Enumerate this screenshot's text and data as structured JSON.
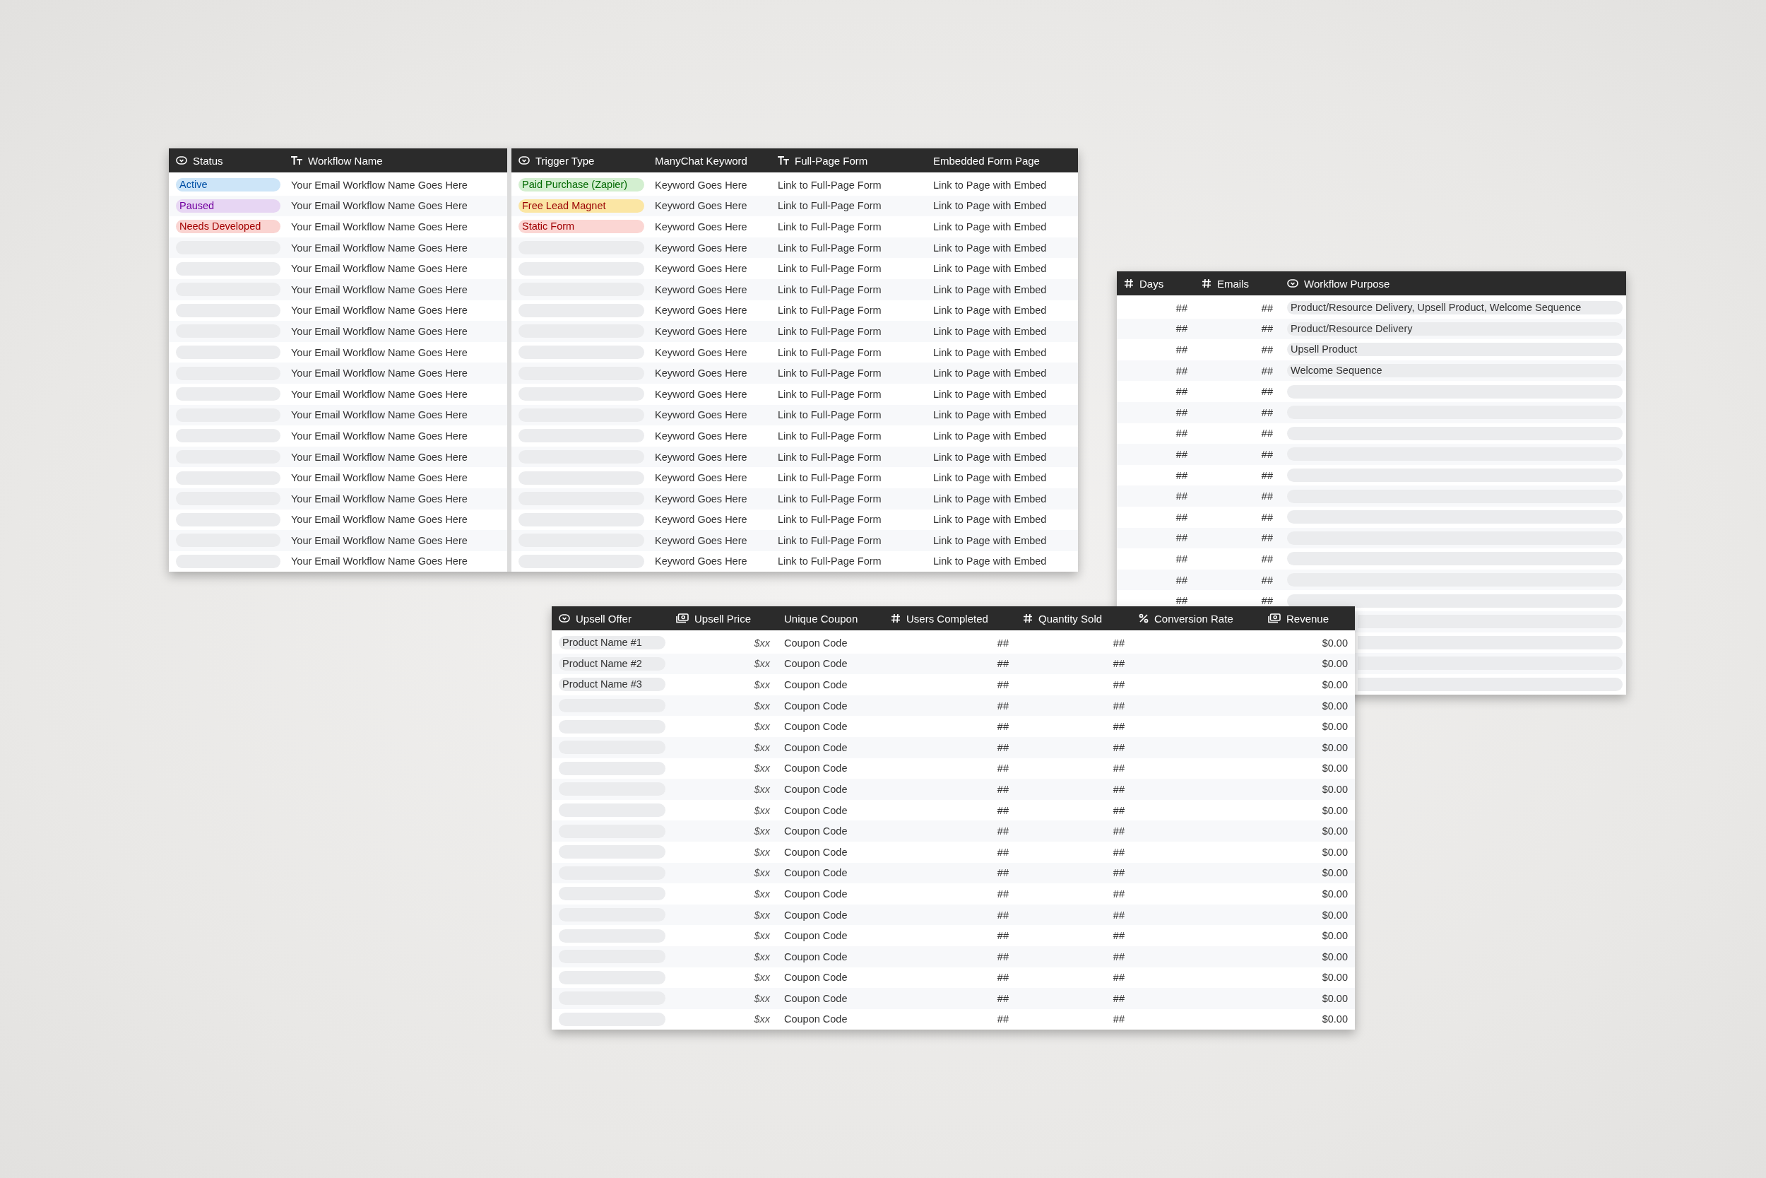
{
  "workflows_table": {
    "columns": [
      {
        "label": "Status",
        "kind": "select"
      },
      {
        "label": "Workflow Name",
        "kind": "text"
      },
      {
        "label": "Trigger Type",
        "kind": "select"
      },
      {
        "label": "ManyChat Keyword",
        "kind": "plain"
      },
      {
        "label": "Full-Page Form",
        "kind": "text"
      },
      {
        "label": "Embedded Form Page",
        "kind": "plain"
      }
    ],
    "rows": [
      {
        "status": {
          "label": "Active",
          "color": "#cde5f8"
        },
        "name": "Your Email Workflow Name Goes Here",
        "trigger": {
          "label": "Paid Purchase (Zapier)",
          "color": "#d3efd0"
        },
        "keyword": "Keyword Goes Here",
        "form": "Link to Full-Page Form",
        "embed": "Link to Page with Embed"
      },
      {
        "status": {
          "label": "Paused",
          "color": "#e7d6f3"
        },
        "name": "Your Email Workflow Name Goes Here",
        "trigger": {
          "label": "Free Lead Magnet",
          "color": "#fbe6a4"
        },
        "keyword": "Keyword Goes Here",
        "form": "Link to Full-Page Form",
        "embed": "Link to Page with Embed"
      },
      {
        "status": {
          "label": "Needs Developed",
          "color": "#fad4d1"
        },
        "name": "Your Email Workflow Name Goes Here",
        "trigger": {
          "label": "Static Form",
          "color": "#fbd6d3"
        },
        "keyword": "Keyword Goes Here",
        "form": "Link to Full-Page Form",
        "embed": "Link to Page with Embed"
      },
      {
        "name": "Your Email Workflow Name Goes Here",
        "keyword": "Keyword Goes Here",
        "form": "Link to Full-Page Form",
        "embed": "Link to Page with Embed"
      },
      {
        "name": "Your Email Workflow Name Goes Here",
        "keyword": "Keyword Goes Here",
        "form": "Link to Full-Page Form",
        "embed": "Link to Page with Embed"
      },
      {
        "name": "Your Email Workflow Name Goes Here",
        "keyword": "Keyword Goes Here",
        "form": "Link to Full-Page Form",
        "embed": "Link to Page with Embed"
      },
      {
        "name": "Your Email Workflow Name Goes Here",
        "keyword": "Keyword Goes Here",
        "form": "Link to Full-Page Form",
        "embed": "Link to Page with Embed"
      },
      {
        "name": "Your Email Workflow Name Goes Here",
        "keyword": "Keyword Goes Here",
        "form": "Link to Full-Page Form",
        "embed": "Link to Page with Embed"
      },
      {
        "name": "Your Email Workflow Name Goes Here",
        "keyword": "Keyword Goes Here",
        "form": "Link to Full-Page Form",
        "embed": "Link to Page with Embed"
      },
      {
        "name": "Your Email Workflow Name Goes Here",
        "keyword": "Keyword Goes Here",
        "form": "Link to Full-Page Form",
        "embed": "Link to Page with Embed"
      },
      {
        "name": "Your Email Workflow Name Goes Here",
        "keyword": "Keyword Goes Here",
        "form": "Link to Full-Page Form",
        "embed": "Link to Page with Embed"
      },
      {
        "name": "Your Email Workflow Name Goes Here",
        "keyword": "Keyword Goes Here",
        "form": "Link to Full-Page Form",
        "embed": "Link to Page with Embed"
      },
      {
        "name": "Your Email Workflow Name Goes Here",
        "keyword": "Keyword Goes Here",
        "form": "Link to Full-Page Form",
        "embed": "Link to Page with Embed"
      },
      {
        "name": "Your Email Workflow Name Goes Here",
        "keyword": "Keyword Goes Here",
        "form": "Link to Full-Page Form",
        "embed": "Link to Page with Embed"
      },
      {
        "name": "Your Email Workflow Name Goes Here",
        "keyword": "Keyword Goes Here",
        "form": "Link to Full-Page Form",
        "embed": "Link to Page with Embed"
      },
      {
        "name": "Your Email Workflow Name Goes Here",
        "keyword": "Keyword Goes Here",
        "form": "Link to Full-Page Form",
        "embed": "Link to Page with Embed"
      },
      {
        "name": "Your Email Workflow Name Goes Here",
        "keyword": "Keyword Goes Here",
        "form": "Link to Full-Page Form",
        "embed": "Link to Page with Embed"
      },
      {
        "name": "Your Email Workflow Name Goes Here",
        "keyword": "Keyword Goes Here",
        "form": "Link to Full-Page Form",
        "embed": "Link to Page with Embed"
      },
      {
        "name": "Your Email Workflow Name Goes Here",
        "keyword": "Keyword Goes Here",
        "form": "Link to Full-Page Form",
        "embed": "Link to Page with Embed"
      }
    ]
  },
  "purpose_table": {
    "columns": [
      {
        "label": "Days",
        "kind": "number"
      },
      {
        "label": "Emails",
        "kind": "number"
      },
      {
        "label": "Workflow Purpose",
        "kind": "select"
      }
    ],
    "rows": [
      {
        "days": "##",
        "emails": "##",
        "purpose": "Product/Resource Delivery, Upsell Product, Welcome Sequence"
      },
      {
        "days": "##",
        "emails": "##",
        "purpose": "Product/Resource Delivery"
      },
      {
        "days": "##",
        "emails": "##",
        "purpose": "Upsell Product"
      },
      {
        "days": "##",
        "emails": "##",
        "purpose": "Welcome Sequence"
      },
      {
        "days": "##",
        "emails": "##"
      },
      {
        "days": "##",
        "emails": "##"
      },
      {
        "days": "##",
        "emails": "##"
      },
      {
        "days": "##",
        "emails": "##"
      },
      {
        "days": "##",
        "emails": "##"
      },
      {
        "days": "##",
        "emails": "##"
      },
      {
        "days": "##",
        "emails": "##"
      },
      {
        "days": "##",
        "emails": "##"
      },
      {
        "days": "##",
        "emails": "##"
      },
      {
        "days": "##",
        "emails": "##"
      },
      {
        "days": "##",
        "emails": "##"
      },
      {},
      {},
      {},
      {}
    ]
  },
  "upsell_table": {
    "columns": [
      {
        "label": "Upsell Offer",
        "kind": "select"
      },
      {
        "label": "Upsell Price",
        "kind": "currency"
      },
      {
        "label": "Unique Coupon",
        "kind": "plain"
      },
      {
        "label": "Users Completed",
        "kind": "number"
      },
      {
        "label": "Quantity Sold",
        "kind": "number"
      },
      {
        "label": "Conversion Rate",
        "kind": "percent"
      },
      {
        "label": "Revenue",
        "kind": "currency"
      }
    ],
    "rows": [
      {
        "offer": "Product Name #1",
        "price": "$xx",
        "coupon": "Coupon Code",
        "users": "##",
        "sold": "##",
        "revenue": "$0.00"
      },
      {
        "offer": "Product Name #2",
        "price": "$xx",
        "coupon": "Coupon Code",
        "users": "##",
        "sold": "##",
        "revenue": "$0.00"
      },
      {
        "offer": "Product Name #3",
        "price": "$xx",
        "coupon": "Coupon Code",
        "users": "##",
        "sold": "##",
        "revenue": "$0.00"
      },
      {
        "price": "$xx",
        "coupon": "Coupon Code",
        "users": "##",
        "sold": "##",
        "revenue": "$0.00"
      },
      {
        "price": "$xx",
        "coupon": "Coupon Code",
        "users": "##",
        "sold": "##",
        "revenue": "$0.00"
      },
      {
        "price": "$xx",
        "coupon": "Coupon Code",
        "users": "##",
        "sold": "##",
        "revenue": "$0.00"
      },
      {
        "price": "$xx",
        "coupon": "Coupon Code",
        "users": "##",
        "sold": "##",
        "revenue": "$0.00"
      },
      {
        "price": "$xx",
        "coupon": "Coupon Code",
        "users": "##",
        "sold": "##",
        "revenue": "$0.00"
      },
      {
        "price": "$xx",
        "coupon": "Coupon Code",
        "users": "##",
        "sold": "##",
        "revenue": "$0.00"
      },
      {
        "price": "$xx",
        "coupon": "Coupon Code",
        "users": "##",
        "sold": "##",
        "revenue": "$0.00"
      },
      {
        "price": "$xx",
        "coupon": "Coupon Code",
        "users": "##",
        "sold": "##",
        "revenue": "$0.00"
      },
      {
        "price": "$xx",
        "coupon": "Coupon Code",
        "users": "##",
        "sold": "##",
        "revenue": "$0.00"
      },
      {
        "price": "$xx",
        "coupon": "Coupon Code",
        "users": "##",
        "sold": "##",
        "revenue": "$0.00"
      },
      {
        "price": "$xx",
        "coupon": "Coupon Code",
        "users": "##",
        "sold": "##",
        "revenue": "$0.00"
      },
      {
        "price": "$xx",
        "coupon": "Coupon Code",
        "users": "##",
        "sold": "##",
        "revenue": "$0.00"
      },
      {
        "price": "$xx",
        "coupon": "Coupon Code",
        "users": "##",
        "sold": "##",
        "revenue": "$0.00"
      },
      {
        "price": "$xx",
        "coupon": "Coupon Code",
        "users": "##",
        "sold": "##",
        "revenue": "$0.00"
      },
      {
        "price": "$xx",
        "coupon": "Coupon Code",
        "users": "##",
        "sold": "##",
        "revenue": "$0.00"
      },
      {
        "price": "$xx",
        "coupon": "Coupon Code",
        "users": "##",
        "sold": "##",
        "revenue": "$0.00"
      }
    ]
  }
}
